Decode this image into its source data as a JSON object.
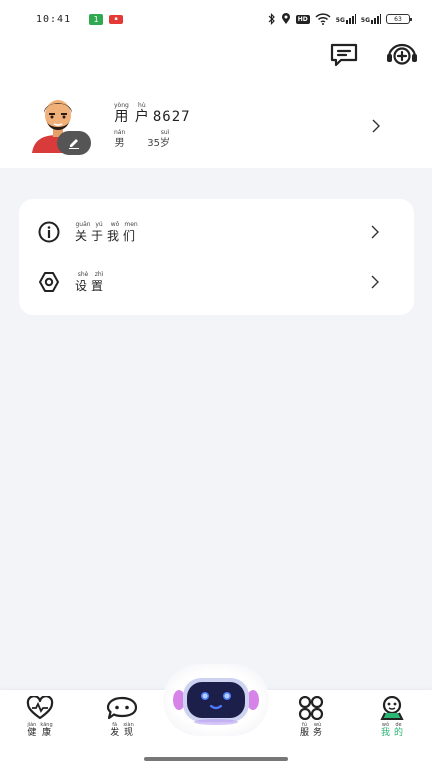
{
  "status_bar": {
    "time": "10:41",
    "app_badge": "1",
    "net_1": "5G",
    "net_2": "5G",
    "hd": "HD",
    "battery": "63"
  },
  "header": {
    "message_icon": "message-square-icon",
    "service_icon": "headset-plus-icon"
  },
  "profile": {
    "name_chars": [
      {
        "py": "yòng",
        "hz": "用"
      },
      {
        "py": "hù",
        "hz": "户"
      }
    ],
    "name_number": "8627",
    "gender": {
      "py": "nán",
      "hz": "男"
    },
    "age": "35",
    "age_unit": {
      "py": "suì",
      "hz": "岁"
    }
  },
  "menu": {
    "items": [
      {
        "icon": "info-icon",
        "chars": [
          {
            "py": "guān",
            "hz": "关"
          },
          {
            "py": "yú",
            "hz": "于"
          },
          {
            "py": "wǒ",
            "hz": "我"
          },
          {
            "py": "men",
            "hz": "们"
          }
        ]
      },
      {
        "icon": "settings-icon",
        "chars": [
          {
            "py": "shè",
            "hz": "设"
          },
          {
            "py": "zhì",
            "hz": "置"
          }
        ]
      }
    ]
  },
  "bottom_nav": {
    "items": [
      {
        "icon": "heart-pulse-icon",
        "chars": [
          {
            "py": "jiàn",
            "hz": "健"
          },
          {
            "py": "kāng",
            "hz": "康"
          }
        ]
      },
      {
        "icon": "chat-bubble-icon",
        "chars": [
          {
            "py": "fā",
            "hz": "发"
          },
          {
            "py": "xiàn",
            "hz": "现"
          }
        ]
      },
      {
        "icon": "apps-grid-icon",
        "chars": [
          {
            "py": "fú",
            "hz": "服"
          },
          {
            "py": "wù",
            "hz": "务"
          }
        ]
      },
      {
        "icon": "person-smile-icon",
        "chars": [
          {
            "py": "wǒ",
            "hz": "我"
          },
          {
            "py": "de",
            "hz": "的"
          }
        ]
      }
    ],
    "active": 3,
    "active_color": "#2bb673"
  }
}
